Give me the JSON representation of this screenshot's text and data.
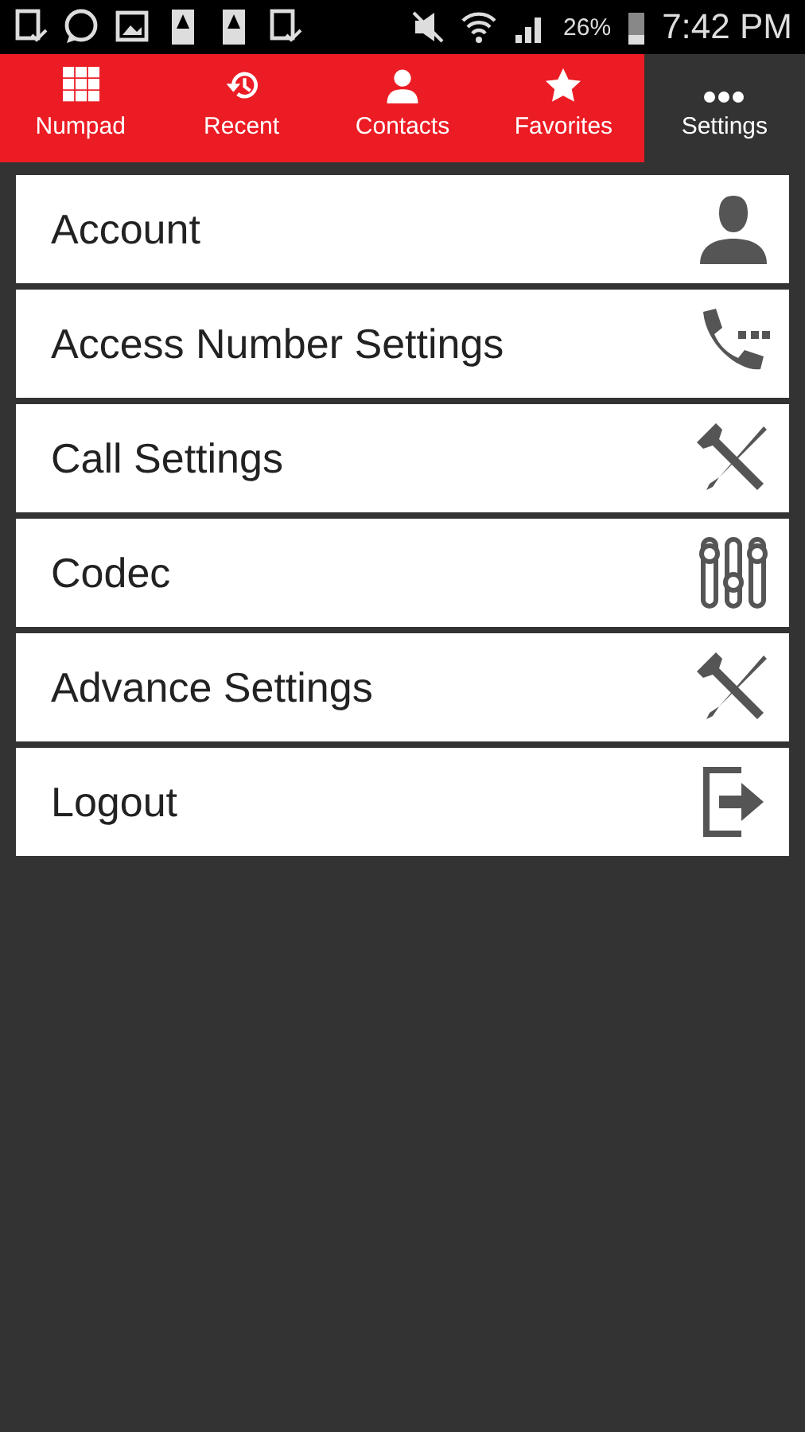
{
  "status_bar": {
    "battery": "26%",
    "time": "7:42 PM"
  },
  "tabs": [
    {
      "label": "Numpad",
      "selected": false
    },
    {
      "label": "Recent",
      "selected": false
    },
    {
      "label": "Contacts",
      "selected": false
    },
    {
      "label": "Favorites",
      "selected": false
    },
    {
      "label": "Settings",
      "selected": true
    }
  ],
  "menu": [
    {
      "label": "Account"
    },
    {
      "label": "Access Number Settings"
    },
    {
      "label": "Call Settings"
    },
    {
      "label": "Codec"
    },
    {
      "label": "Advance Settings"
    },
    {
      "label": "Logout"
    }
  ]
}
